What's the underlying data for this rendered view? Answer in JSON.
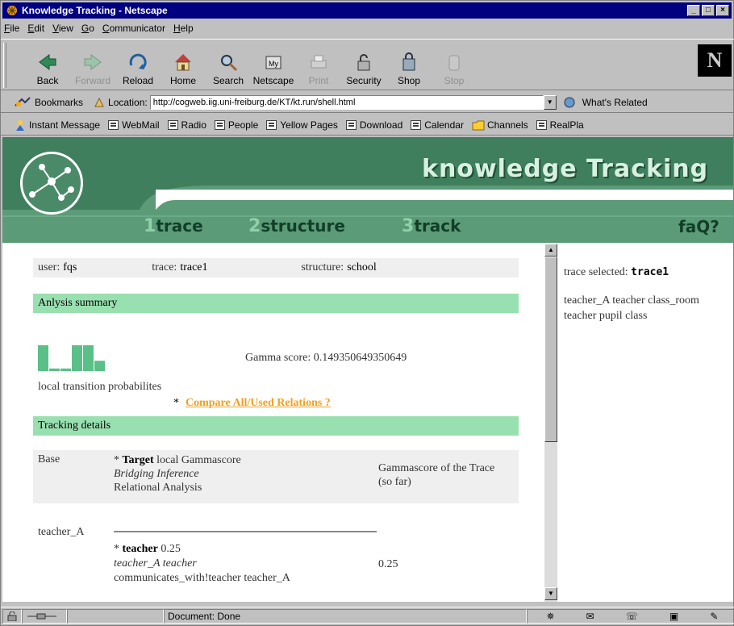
{
  "window": {
    "title": "Knowledge Tracking - Netscape",
    "controls": [
      "_",
      "□",
      "×"
    ]
  },
  "menu": [
    {
      "label": "File",
      "key": "F",
      "rest": "ile"
    },
    {
      "label": "Edit",
      "key": "E",
      "rest": "dit"
    },
    {
      "label": "View",
      "key": "V",
      "rest": "iew"
    },
    {
      "label": "Go",
      "key": "G",
      "rest": "o"
    },
    {
      "label": "Communicator",
      "key": "C",
      "rest": "ommunicator"
    },
    {
      "label": "Help",
      "key": "H",
      "rest": "elp"
    }
  ],
  "toolbar": {
    "back": "Back",
    "forward": "Forward",
    "reload": "Reload",
    "home": "Home",
    "search": "Search",
    "netscape": "Netscape",
    "print": "Print",
    "security": "Security",
    "shop": "Shop",
    "stop": "Stop",
    "logo": "N"
  },
  "location": {
    "bookmarks": "Bookmarks",
    "label": "Location:",
    "url": "http://cogweb.iig.uni-freiburg.de/KT/kt.run/shell.html",
    "related": "What's Related"
  },
  "personal": [
    "Instant Message",
    "WebMail",
    "Radio",
    "People",
    "Yellow Pages",
    "Download",
    "Calendar",
    "Channels",
    "RealPla"
  ],
  "banner": {
    "title": "knowledge Tracking",
    "tabs": [
      {
        "num": "1",
        "label": "trace"
      },
      {
        "num": "2",
        "label": "structure"
      },
      {
        "num": "3",
        "label": "track"
      }
    ],
    "faq": "faQ?"
  },
  "info": {
    "user_label": "user:",
    "user": "fqs",
    "trace_label": "trace:",
    "trace": "trace1",
    "structure_label": "structure:",
    "structure": "school"
  },
  "summary": {
    "heading": "Anlysis summary",
    "gamma": "Gamma score: 0.149350649350649",
    "ltp": "local transition probabilites",
    "star": "*",
    "compare": "Compare All/Used Relations ?",
    "bars": [
      1,
      0.1,
      0.1,
      1,
      1,
      0.4
    ]
  },
  "tracking": {
    "heading": "Tracking details",
    "base": "Base",
    "target": "Target",
    "target_rest": "local Gammascore",
    "bridging": "Bridging Inference",
    "relational": "Relational Analysis",
    "gamma_col": "Gammascore of the Trace (so far)",
    "row_name": "teacher_A",
    "row_bold": "teacher",
    "row_score": "0.25",
    "row_italic": "teacher_A teacher",
    "row_rel": "communicates_with!teacher teacher_A",
    "row_trace": "0.25"
  },
  "sidebar": {
    "selected_label": "trace selected:",
    "selected": "trace1",
    "text": "teacher_A teacher class_room teacher pupil class"
  },
  "status": {
    "text": "Document: Done"
  },
  "colors": {
    "banner": "#5b9b78",
    "section": "#99e0b0",
    "link": "#f0a020",
    "title": "#000080"
  }
}
